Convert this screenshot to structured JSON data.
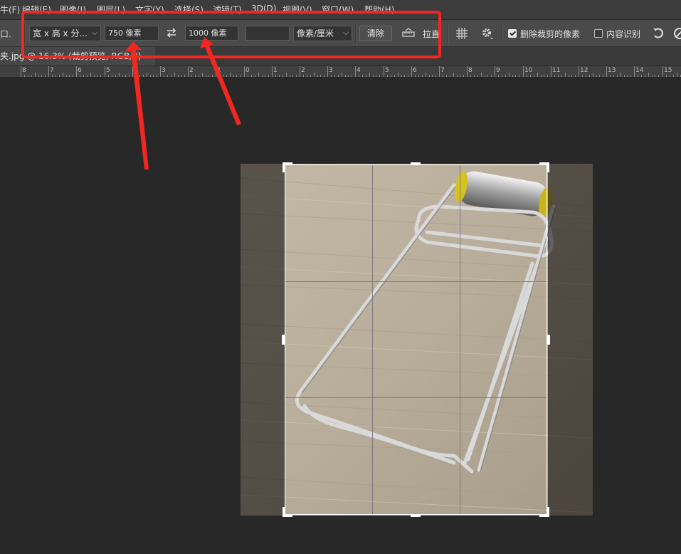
{
  "menu": {
    "items": [
      "牛(F)",
      "编辑(E)",
      "图像(I)",
      "图层(L)",
      "文字(Y)",
      "选择(S)",
      "滤镜(T)",
      "3D(D)",
      "视图(V)",
      "窗口(W)",
      "帮助(H)"
    ]
  },
  "options": {
    "tool_preset_label": "口.",
    "ratio_select": "宽 x 高 x 分...",
    "width_value": "750 像素",
    "height_value": "1000 像素",
    "resolution_value": "",
    "units_select": "像素/厘米",
    "clear_label": "清除",
    "straighten_label": "拉直",
    "delete_cropped_label": "删除裁剪的像素",
    "delete_cropped_checked": true,
    "content_aware_label": "内容识别",
    "content_aware_checked": false
  },
  "tab": {
    "title": "夹.jpg @ 16.3% (裁剪预览, RGB/8)"
  },
  "ruler": {
    "labels": [
      "8",
      "7",
      "6",
      "5",
      "4",
      "3",
      "2",
      "1",
      "0",
      "1",
      "2",
      "3",
      "4",
      "5",
      "6",
      "7",
      "8",
      "9",
      "10",
      "11",
      "12",
      "13",
      "14",
      "15"
    ]
  },
  "colors": {
    "annotation_red": "#f2271f",
    "crop_border": "#ffffff",
    "wood": "#b9ad9c"
  }
}
